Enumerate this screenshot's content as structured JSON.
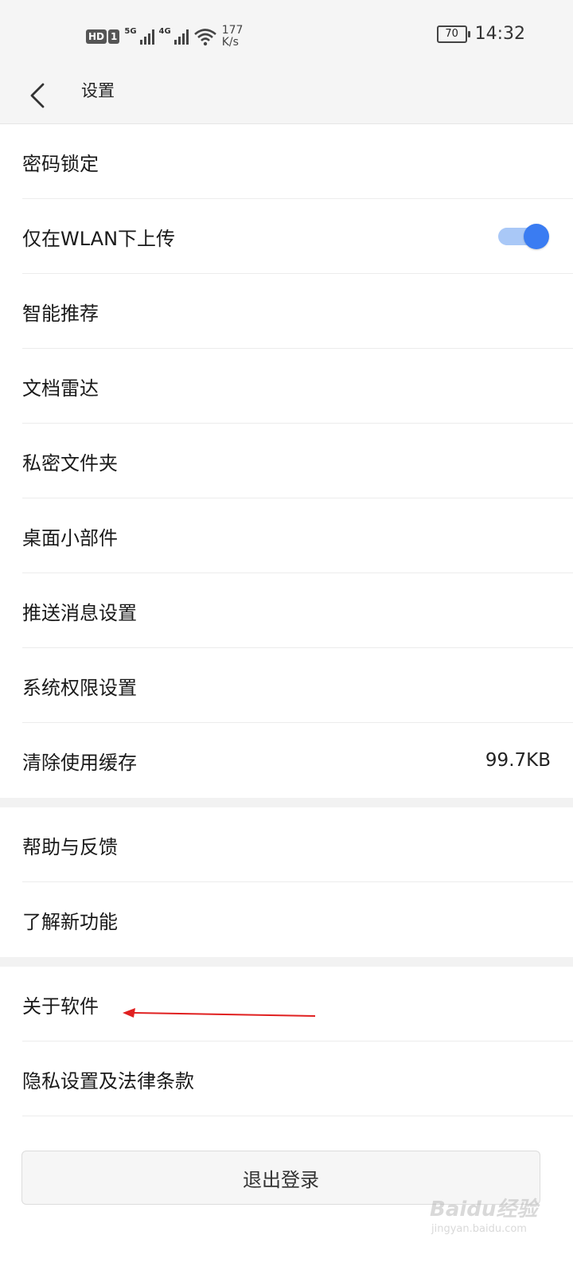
{
  "status_bar": {
    "hd": "HD",
    "sim": "1",
    "net1": "5G",
    "net2": "4G",
    "speed_value": "177",
    "speed_unit": "K/s",
    "battery": "70",
    "time": "14:32"
  },
  "header": {
    "title": "设置",
    "back_icon": "chevron-left-icon"
  },
  "section1": [
    {
      "label": "密码锁定"
    },
    {
      "label": "仅在WLAN下上传",
      "toggle": true
    },
    {
      "label": "智能推荐"
    },
    {
      "label": "文档雷达"
    },
    {
      "label": "私密文件夹"
    },
    {
      "label": "桌面小部件"
    },
    {
      "label": "推送消息设置"
    },
    {
      "label": "系统权限设置"
    },
    {
      "label": "清除使用缓存",
      "value": "99.7KB"
    }
  ],
  "section2": [
    {
      "label": "帮助与反馈"
    },
    {
      "label": "了解新功能"
    }
  ],
  "section3": [
    {
      "label": "关于软件"
    },
    {
      "label": "隐私设置及法律条款"
    }
  ],
  "logout_label": "退出登录",
  "watermark": {
    "main": "Baidu经验",
    "sub": "jingyan.baidu.com"
  },
  "colors": {
    "toggle_on": "#3a7cf2",
    "toggle_track": "#a9c8f7",
    "annotation_arrow": "#e02020"
  }
}
